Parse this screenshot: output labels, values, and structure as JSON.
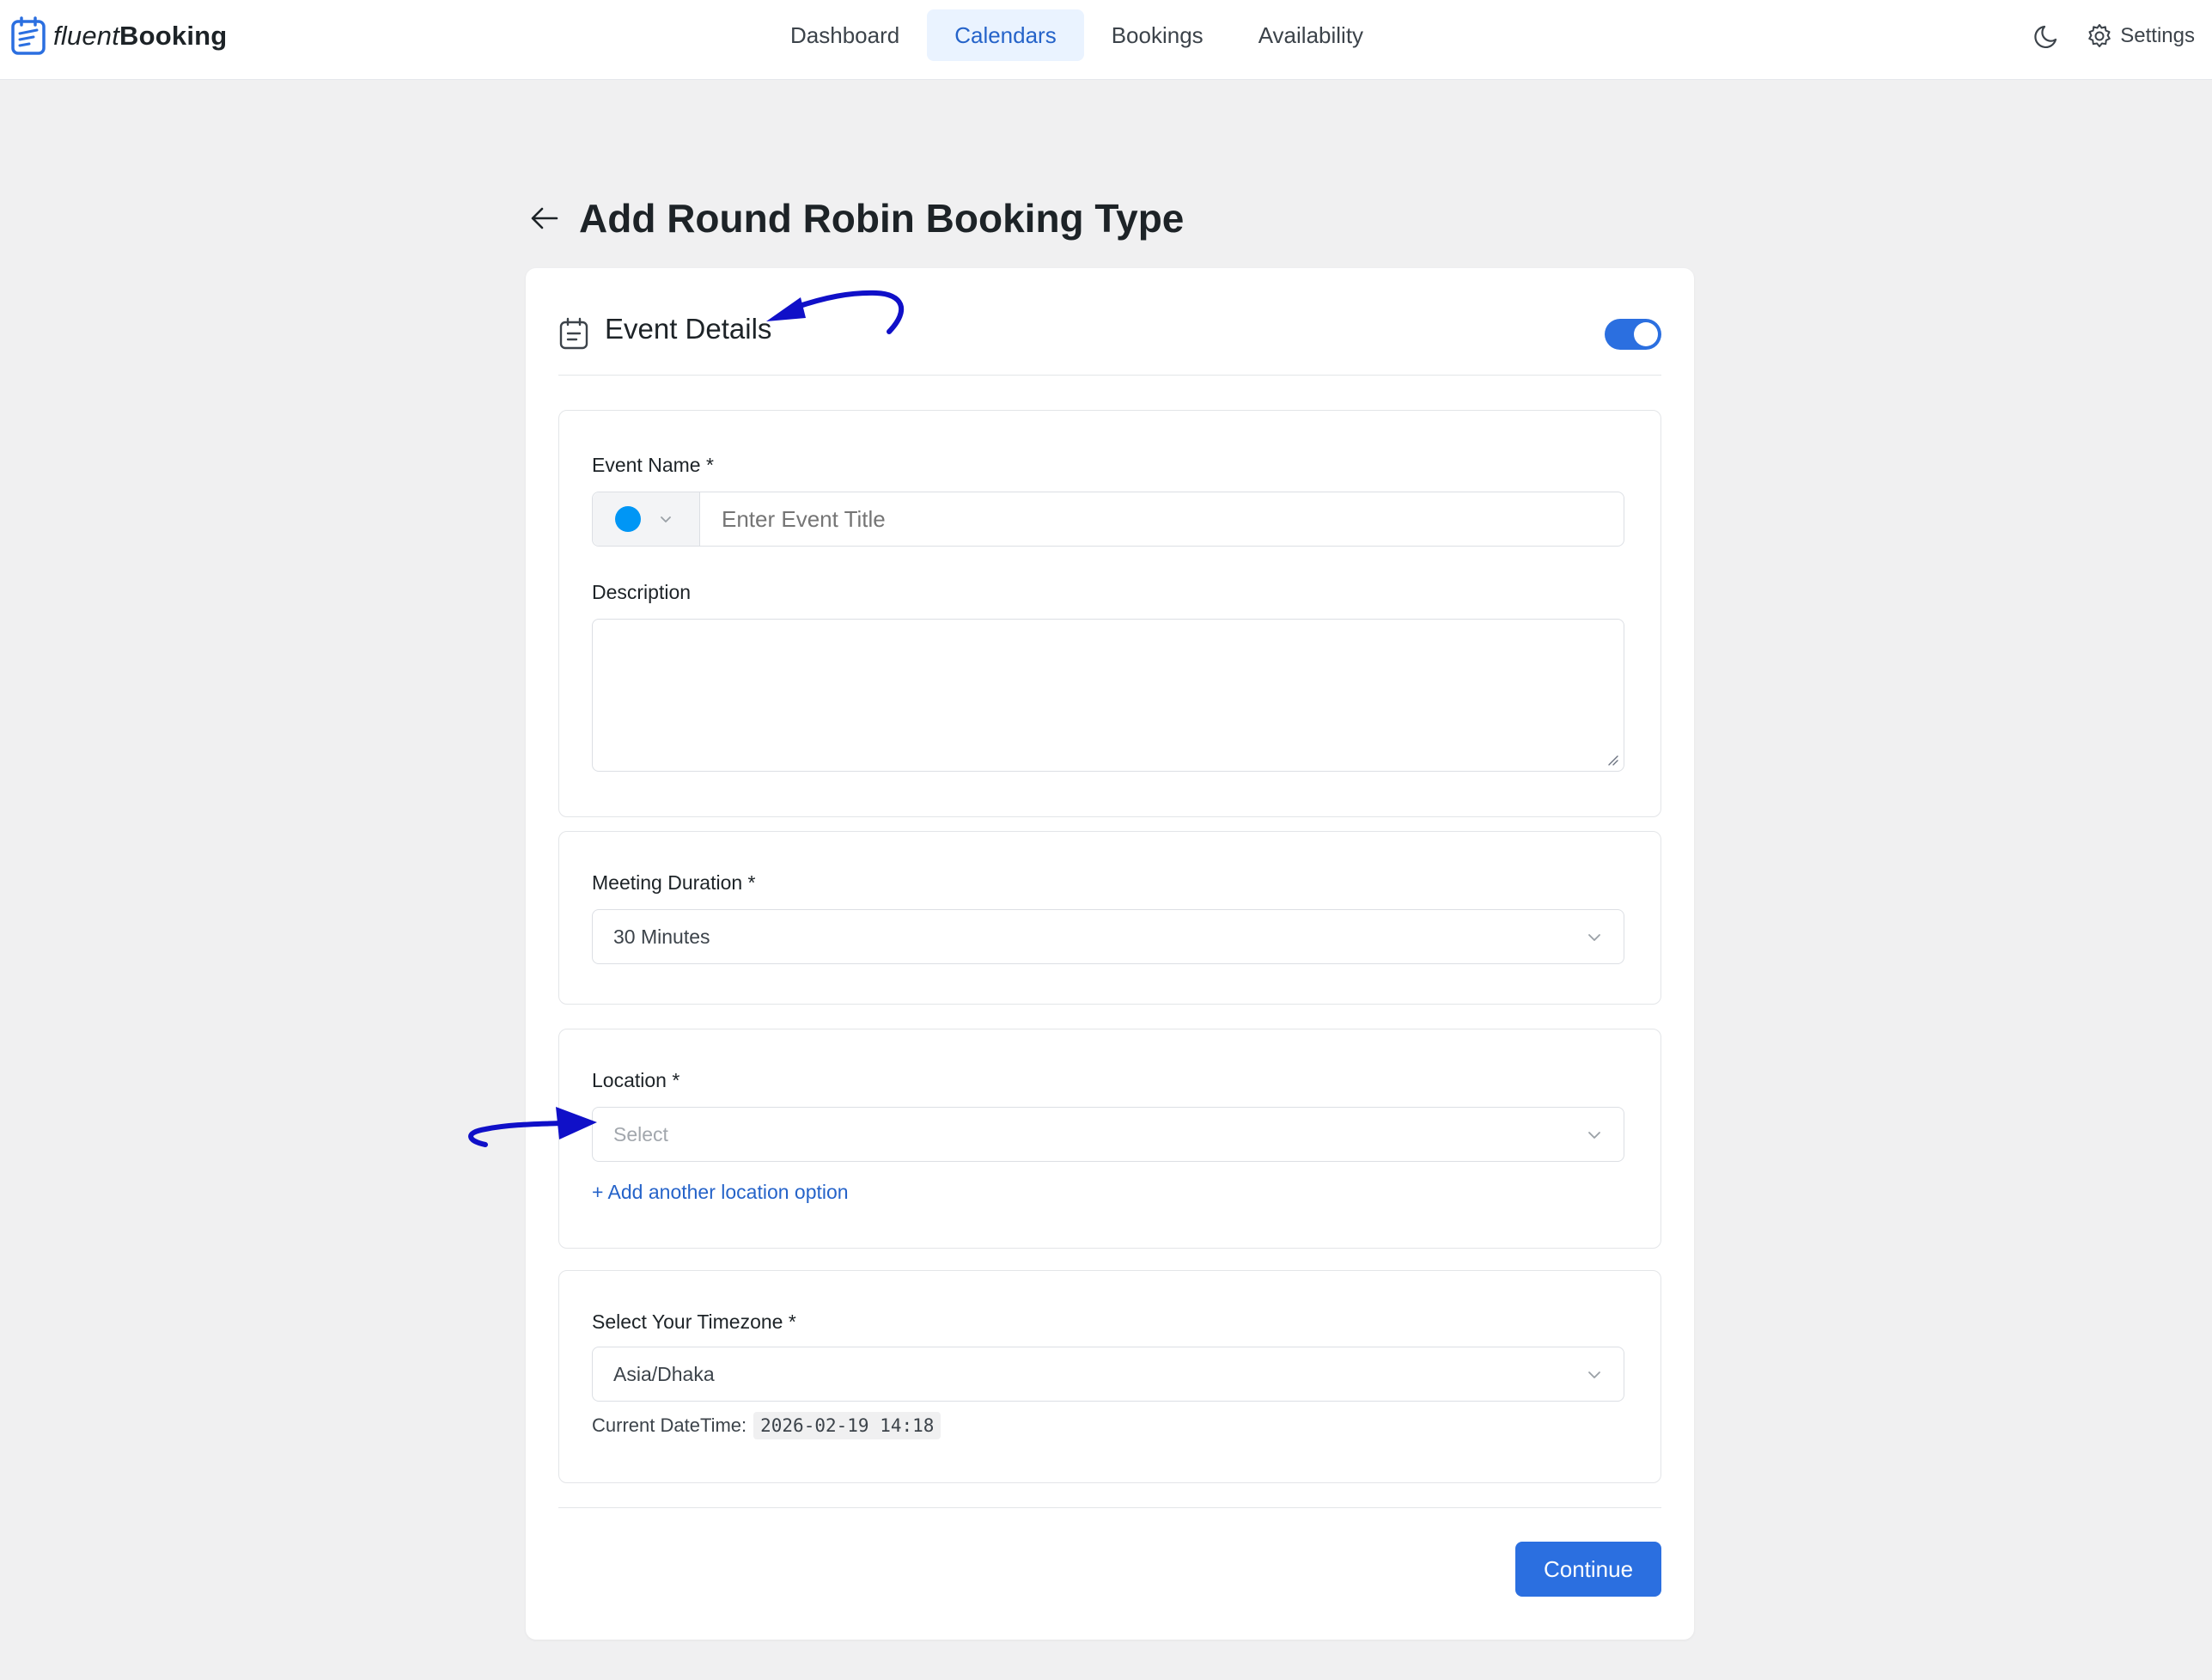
{
  "app": {
    "logo_prefix": "fluent",
    "logo_suffix": "Booking"
  },
  "nav": {
    "items": [
      {
        "label": "Dashboard",
        "active": false
      },
      {
        "label": "Calendars",
        "active": true
      },
      {
        "label": "Bookings",
        "active": false
      },
      {
        "label": "Availability",
        "active": false
      }
    ],
    "settings_label": "Settings"
  },
  "page": {
    "title": "Add Round Robin Booking Type"
  },
  "card": {
    "title": "Event Details",
    "toggle_on": true
  },
  "event_name": {
    "label": "Event Name *",
    "placeholder": "Enter Event Title",
    "color": "#0096f5"
  },
  "description": {
    "label": "Description"
  },
  "duration": {
    "label": "Meeting Duration *",
    "value": "30 Minutes"
  },
  "location": {
    "label": "Location *",
    "placeholder": "Select",
    "add_link": "+ Add another location option"
  },
  "timezone": {
    "label": "Select Your Timezone *",
    "value": "Asia/Dhaka",
    "current_label": "Current DateTime:",
    "current_value": "2026-02-19 14:18"
  },
  "actions": {
    "continue_label": "Continue"
  },
  "colors": {
    "accent": "#2b6fe0",
    "link": "#2563c9",
    "annotation_arrow": "#1010c8"
  }
}
